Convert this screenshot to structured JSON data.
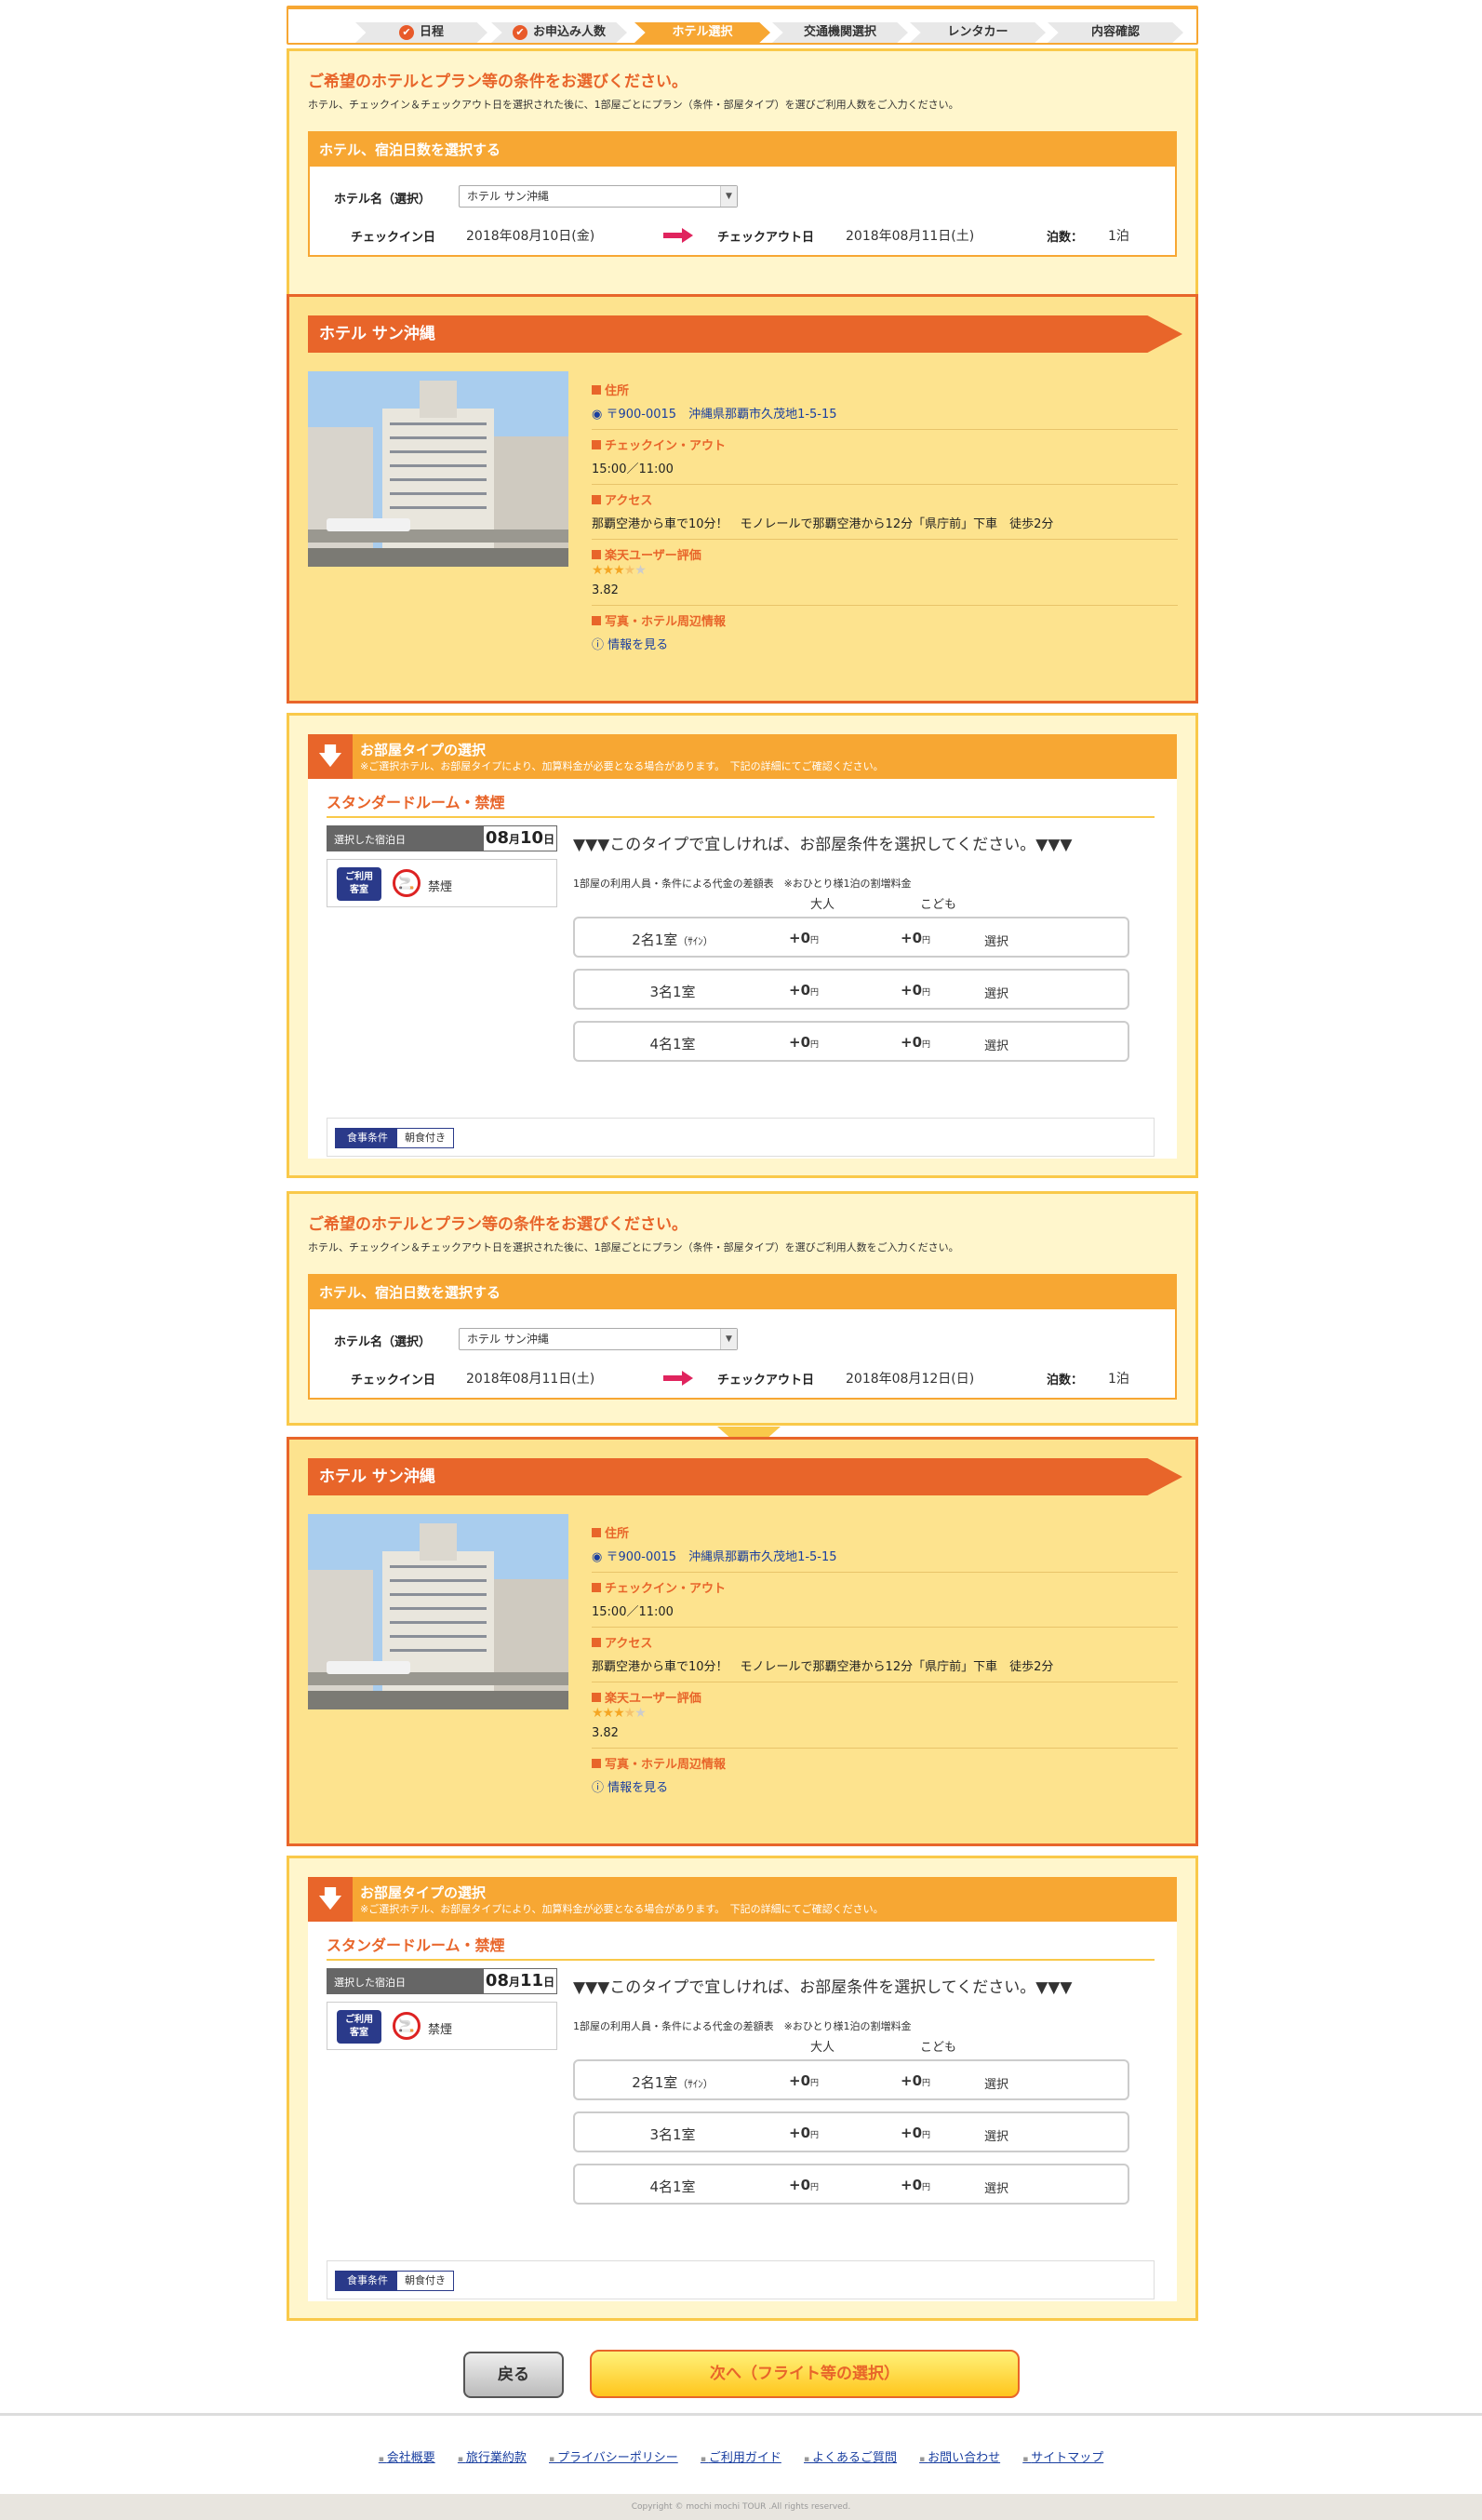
{
  "steps": [
    {
      "label": "日程",
      "done": true
    },
    {
      "label": "お申込み人数",
      "done": true
    },
    {
      "label": "ホテル選択",
      "done": false
    },
    {
      "label": "交通機関選択",
      "done": false
    },
    {
      "label": "レンタカー",
      "done": false
    },
    {
      "label": "内容確認",
      "done": false
    }
  ],
  "check_glyph": "✔",
  "common": {
    "select_title": "ご希望のホテルとプラン等の条件をお選びください。",
    "select_sub": "ホテル、チェックイン＆チェックアウト日を選択された後に、1部屋ごとにプラン（条件・部屋タイプ）を選びご利用人数をご入力ください。",
    "box_header": "ホテル、宿泊日数を選択する",
    "hotel_label": "ホテル名（選択）",
    "checkin_label": "チェックイン日",
    "checkout_label": "チェックアウト日",
    "nights_label": "泊数：",
    "hotel_value": "ホテル サン沖縄",
    "hotel_name": "ホテル サン沖縄",
    "address_h": "住所",
    "address": "〒900-0015　沖縄県那覇市久茂地1-5-15",
    "inout_h": "チェックイン・アウト",
    "inout": "15:00／11:00",
    "access_h": "アクセス",
    "access": "那覇空港から車で10分！　モノレールで那覇空港から12分「県庁前」下車　徒歩2分",
    "rating_h": "楽天ユーザー評価",
    "rating": "3.82",
    "photo_h": "写真・ホテル周辺情報",
    "photo_link": "情報を見る",
    "room_hd": "お部屋タイプの選択",
    "room_hd_sub": "※ご選択ホテル、お部屋タイプにより、加算料金が必要となる場合があります。　下記の詳細にてご確認ください。",
    "room_type": "スタンダードルーム・禁煙",
    "date_label": "選択した宿泊日",
    "facility_tag1": "ご利用",
    "facility_tag2": "客室",
    "nosmoke": "禁煙",
    "pick_text": "▼▼▼このタイプで宜しければ、お部屋条件を選択してください。▼▼▼",
    "note": "1部屋の利用人員・条件による代金の差額表　※おひとり様1泊の割増料金",
    "adult": "大人",
    "child": "こども",
    "meal_label": "食事条件",
    "meal_value": "朝食付き",
    "price_rows": [
      {
        "name": "2名1室",
        "sub": "（ｻｲﾝ）",
        "adult": "+0",
        "child": "+0",
        "yen": "円",
        "select": "選択"
      },
      {
        "name": "3名1室",
        "sub": "",
        "adult": "+0",
        "child": "+0",
        "yen": "円",
        "select": "選択"
      },
      {
        "name": "4名1室",
        "sub": "",
        "adult": "+0",
        "child": "+0",
        "yen": "円",
        "select": "選択"
      }
    ]
  },
  "stays": [
    {
      "checkin": "2018年08月10日(金)",
      "checkout": "2018年08月11日(土)",
      "nights": "1泊",
      "day_month": "08",
      "day_sep": "月",
      "day_day": "10",
      "day_suffix": "日"
    },
    {
      "checkin": "2018年08月11日(土)",
      "checkout": "2018年08月12日(日)",
      "nights": "1泊",
      "day_month": "08",
      "day_sep": "月",
      "day_day": "11",
      "day_suffix": "日"
    }
  ],
  "buttons": {
    "back": "戻る",
    "next": "次へ（フライト等の選択）"
  },
  "footer": {
    "links": [
      "会社概要",
      "旅行業約款",
      "プライバシーポリシー",
      "ご利用ガイド",
      "よくあるご質問",
      "お問い合わせ",
      "サイトマップ"
    ],
    "copyright": "Copyright © mochi mochi TOUR .All rights reserved."
  },
  "colors": {
    "accent": "#f7a733",
    "brand": "#e8652a",
    "panel": "#fff6cc",
    "hotel_bg": "#fde38e",
    "link": "#1a3fa0"
  }
}
